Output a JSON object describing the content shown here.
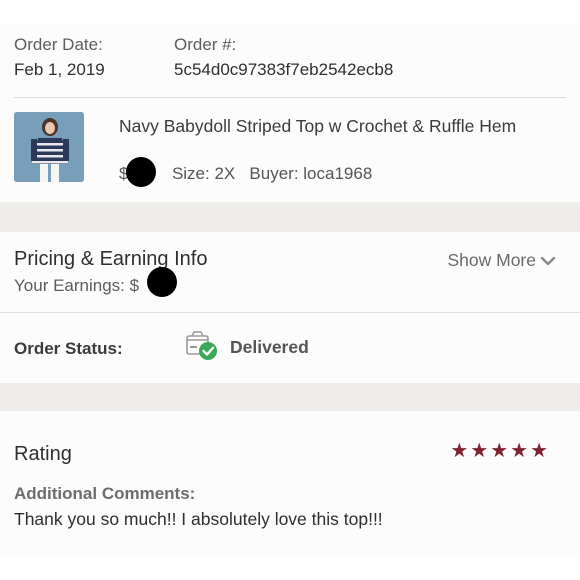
{
  "order": {
    "date_label": "Order Date:",
    "date_value": "Feb 1, 2019",
    "number_label": "Order #:",
    "number_value": "5c54d0c97383f7eb2542ecb8"
  },
  "item": {
    "title": "Navy Babydoll Striped Top w Crochet & Ruffle Hem",
    "price_prefix": "$",
    "size": "Size: 2X",
    "buyer": "Buyer: loca1968"
  },
  "pricing": {
    "title": "Pricing & Earning Info",
    "earnings_label": "Your Earnings: $",
    "show_more": "Show More"
  },
  "status": {
    "label": "Order Status:",
    "value": "Delivered"
  },
  "rating": {
    "title": "Rating",
    "stars": "★★★★★",
    "additional_label": "Additional Comments:",
    "comment": "Thank you so much!! I absolutely love this top!!!"
  },
  "colors": {
    "accent_stars": "#7f2333",
    "check_green": "#3aa856"
  }
}
